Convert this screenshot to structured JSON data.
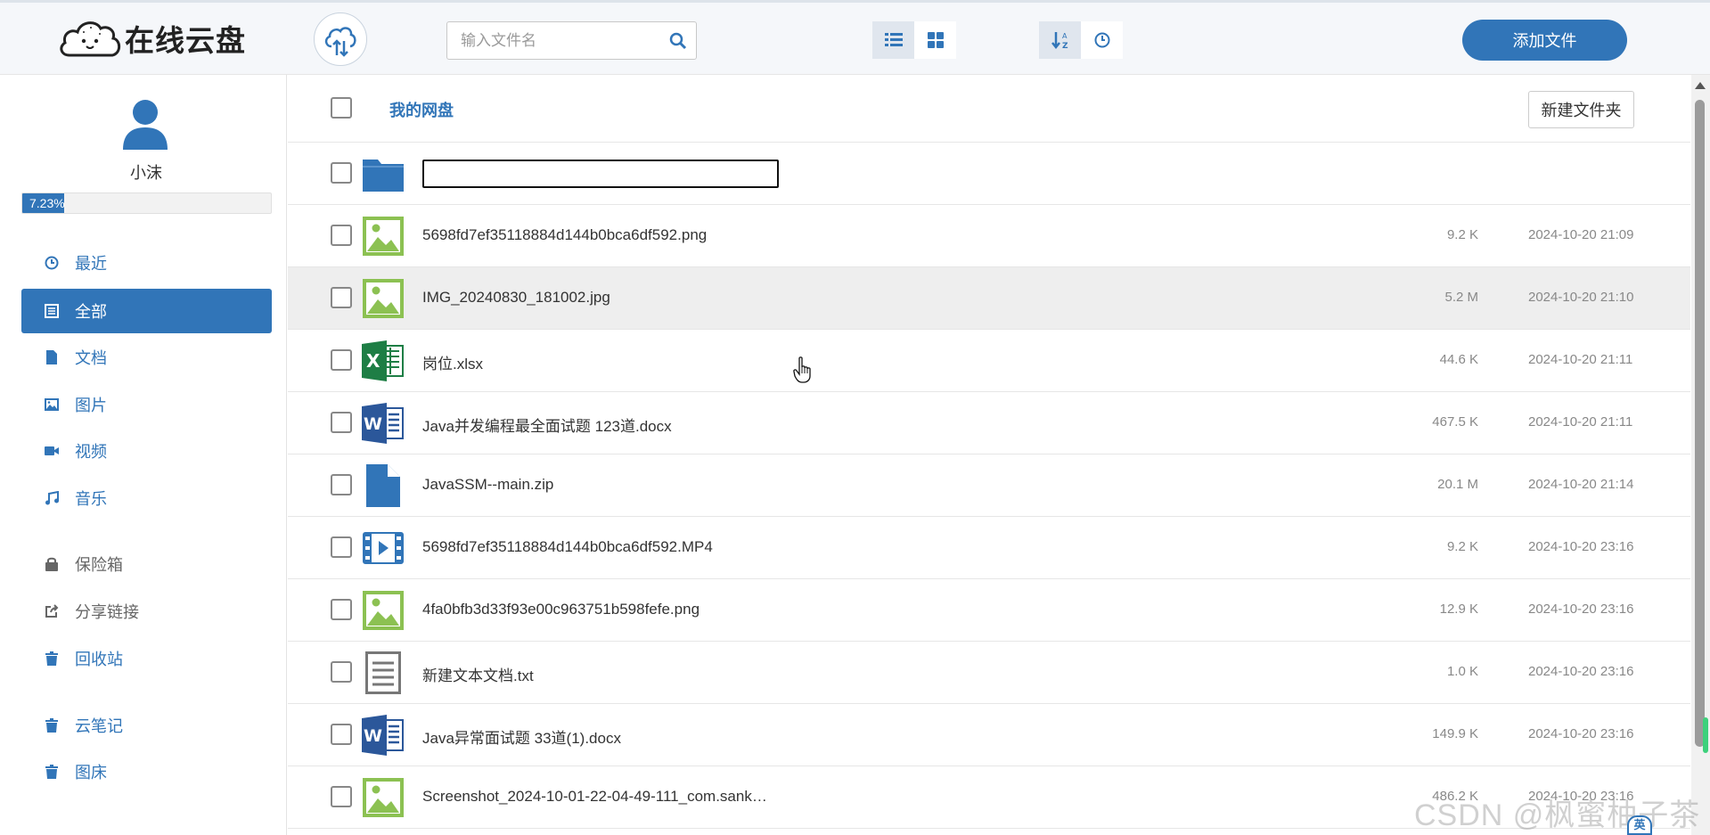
{
  "app": {
    "logo_text": "在线云盘",
    "search_placeholder": "输入文件名",
    "add_file_label": "添加文件"
  },
  "user": {
    "name": "小沫",
    "quota_percent_label": "7.23%",
    "quota_fraction": 0.0723
  },
  "sidebar": {
    "items": [
      {
        "label": "最近",
        "icon": "clock-icon"
      },
      {
        "label": "全部",
        "icon": "list-icon",
        "active": true
      },
      {
        "label": "文档",
        "icon": "document-icon"
      },
      {
        "label": "图片",
        "icon": "image-icon"
      },
      {
        "label": "视频",
        "icon": "video-icon"
      },
      {
        "label": "音乐",
        "icon": "music-icon"
      },
      {
        "label": "保险箱",
        "icon": "lock-icon"
      },
      {
        "label": "分享链接",
        "icon": "share-icon"
      },
      {
        "label": "回收站",
        "icon": "trash-icon"
      },
      {
        "label": "云笔记",
        "icon": "trash-icon"
      },
      {
        "label": "图床",
        "icon": "trash-icon"
      }
    ]
  },
  "list": {
    "breadcrumb": "我的网盘",
    "new_folder_label": "新建文件夹",
    "rename_value": "",
    "files": [
      {
        "name": "5698fd7ef35118884d144b0bca6df592.png",
        "size": "9.2 K",
        "date": "2024-10-20 21:09",
        "type": "image"
      },
      {
        "name": "IMG_20240830_181002.jpg",
        "size": "5.2 M",
        "date": "2024-10-20 21:10",
        "type": "image"
      },
      {
        "name": "岗位.xlsx",
        "size": "44.6 K",
        "date": "2024-10-20 21:11",
        "type": "excel"
      },
      {
        "name": "Java并发编程最全面试题 123道.docx",
        "size": "467.5 K",
        "date": "2024-10-20 21:11",
        "type": "word"
      },
      {
        "name": "JavaSSM--main.zip",
        "size": "20.1 M",
        "date": "2024-10-20 21:14",
        "type": "file"
      },
      {
        "name": "5698fd7ef35118884d144b0bca6df592.MP4",
        "size": "9.2 K",
        "date": "2024-10-20 23:16",
        "type": "video"
      },
      {
        "name": "4fa0bfb3d33f93e00c963751b598fefe.png",
        "size": "12.9 K",
        "date": "2024-10-20 23:16",
        "type": "image"
      },
      {
        "name": "新建文本文档.txt",
        "size": "1.0 K",
        "date": "2024-10-20 23:16",
        "type": "text"
      },
      {
        "name": "Java异常面试题 33道(1).docx",
        "size": "149.9 K",
        "date": "2024-10-20 23:16",
        "type": "word"
      },
      {
        "name": "Screenshot_2024-10-01-22-04-49-111_com.sank…",
        "size": "486.2 K",
        "date": "2024-10-20 23:16",
        "type": "image"
      }
    ]
  },
  "watermark": "CSDN @枫蜜柚子茶",
  "ime_label": "英",
  "colors": {
    "accent": "#3175b8",
    "excel": "#1e7e45",
    "word": "#2b579a",
    "image": "#8cc152"
  }
}
